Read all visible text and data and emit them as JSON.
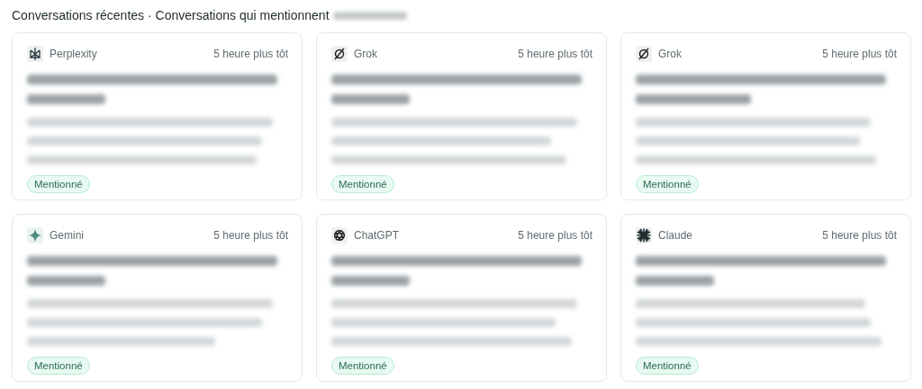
{
  "heading": "Conversations récentes · Conversations qui mentionnent",
  "cards": [
    {
      "model": "Perplexity",
      "kind": "perplexity",
      "time": "5 heure plus tôt",
      "badge": "Mentionné"
    },
    {
      "model": "Grok",
      "kind": "grok",
      "time": "5 heure plus tôt",
      "badge": "Mentionné"
    },
    {
      "model": "Grok",
      "kind": "grok",
      "time": "5 heure plus tôt",
      "badge": "Mentionné"
    },
    {
      "model": "Gemini",
      "kind": "gemini",
      "time": "5 heure plus tôt",
      "badge": "Mentionné"
    },
    {
      "model": "ChatGPT",
      "kind": "chatgpt",
      "time": "5 heure plus tôt",
      "badge": "Mentionné"
    },
    {
      "model": "Claude",
      "kind": "claude",
      "time": "5 heure plus tôt",
      "badge": "Mentionné"
    }
  ]
}
